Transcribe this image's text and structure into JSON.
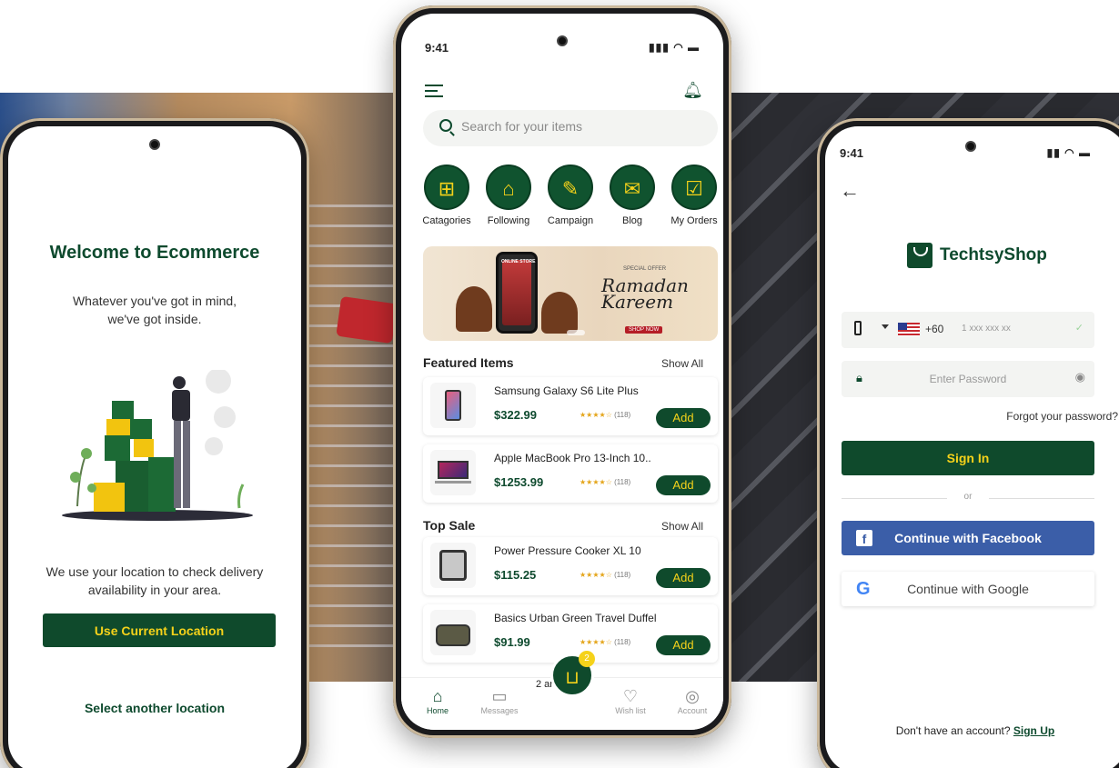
{
  "left_screen": {
    "title": "Welcome to Ecommerce",
    "subtitle_line1": "Whatever you've got in mind,",
    "subtitle_line2": "we've got inside.",
    "location_text_line1": "We use your location to check delivery",
    "location_text_line2": "availability in your area.",
    "use_location_label": "Use Current Location",
    "select_location_label": "Select another location"
  },
  "center_screen": {
    "time": "9:41",
    "search_placeholder": "Search for your items",
    "categories": [
      {
        "label": "Catagories",
        "icon": "grid-icon"
      },
      {
        "label": "Following",
        "icon": "store-icon"
      },
      {
        "label": "Campaign",
        "icon": "megaphone-icon"
      },
      {
        "label": "Blog",
        "icon": "chat-icon"
      },
      {
        "label": "My Orders",
        "icon": "orders-icon"
      }
    ],
    "banner": {
      "phone_label": "ONLINE STORE",
      "special_offer": "SPECIAL OFFER",
      "headline_line1": "Ramadan",
      "headline_line2": "Kareem",
      "cta": "SHOP NOW"
    },
    "featured_title": "Featured Items",
    "top_sale_title": "Top Sale",
    "show_all": "Show All",
    "featured_items": [
      {
        "name": "Samsung Galaxy S6 Lite Plus",
        "price": "$322.99",
        "reviews": "(118)",
        "rating": 4,
        "add": "Add"
      },
      {
        "name": "Apple MacBook Pro 13-Inch 10..",
        "price": "$1253.99",
        "reviews": "(118)",
        "rating": 4,
        "add": "Add"
      }
    ],
    "top_sale_items": [
      {
        "name": "Power Pressure Cooker XL 10",
        "price": "$115.25",
        "reviews": "(118)",
        "rating": 4,
        "add": "Add"
      },
      {
        "name": "Basics Urban Green Travel Duffel",
        "price": "$91.99",
        "reviews": "(118)",
        "rating": 4,
        "add": "Add"
      }
    ],
    "cart_badge": "2",
    "cart_peek_text": "2 ar",
    "tabs": [
      {
        "label": "Home",
        "icon": "home-icon",
        "active": true
      },
      {
        "label": "Messages",
        "icon": "messages-icon",
        "active": false
      },
      {
        "label": "Wish list",
        "icon": "heart-icon",
        "active": false
      },
      {
        "label": "Account",
        "icon": "account-icon",
        "active": false
      }
    ]
  },
  "right_screen": {
    "time": "9:41",
    "brand": "TechtsyShop",
    "country_code": "+60",
    "phone_placeholder": "1 xxx xxx xx",
    "password_placeholder": "Enter Password",
    "forgot_label": "Forgot your password?",
    "sign_in_label": "Sign In",
    "or_label": "or",
    "facebook_label": "Continue with Facebook",
    "google_label": "Continue with Google",
    "no_account_label": "Don't have an account?",
    "sign_up_label": "Sign Up"
  },
  "colors": {
    "brand_green": "#0f4a2c",
    "accent_yellow": "#f5d21a",
    "facebook_blue": "#3b5ea8"
  }
}
